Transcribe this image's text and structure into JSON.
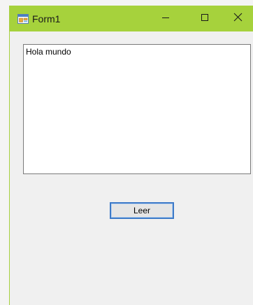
{
  "window": {
    "title": "Form1",
    "titlebar_color": "#a6d23c",
    "icons": {
      "app": "form-app-icon",
      "minimize": "minimize-icon",
      "maximize": "maximize-icon",
      "close": "close-icon"
    }
  },
  "form": {
    "textbox_value": "Hola mundo",
    "read_button_label": "Leer",
    "button_accent": "#3d7ac8"
  }
}
